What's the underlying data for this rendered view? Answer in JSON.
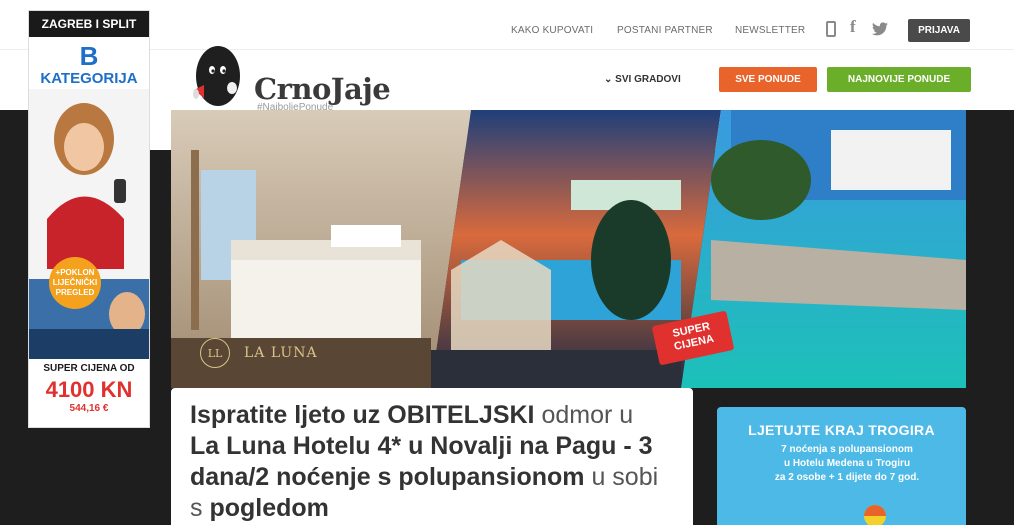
{
  "topnav": {
    "links": [
      "KAKO KUPOVATI",
      "POSTANI PARTNER",
      "NEWSLETTER"
    ],
    "login_label": "PRIJAVA",
    "icons": [
      "phone-icon",
      "facebook-icon",
      "twitter-icon"
    ]
  },
  "header": {
    "brand": "CrnoJaje",
    "tagline": "#NajboljePonude",
    "city_select": "SVI GRADOVI",
    "all_offers_label": "SVE PONUDE",
    "newest_offers_label": "NAJNOVIJE PONUDE"
  },
  "colors": {
    "all_offers": "#e8642a",
    "newest_offers": "#6aae2a",
    "dark_background": "#1e1e1e",
    "promo_blue": "#4db9e6",
    "ad_blue": "#1e6fc8",
    "price_red": "#e0312f"
  },
  "hero": {
    "hotel_logo_text": "LA LUNA",
    "hotel_logo_mark": "LL",
    "tag_line1": "SUPER",
    "tag_line2": "CIJENA"
  },
  "offer": {
    "title_parts": [
      {
        "text": "Ispratite ljeto uz OBITELJSKI",
        "bold": true
      },
      {
        "text": " odmor u ",
        "bold": false
      },
      {
        "text": "La Luna Hotelu 4* u Novalji na Pagu - 3 dana/2 noćenje s polupansionom",
        "bold": true
      },
      {
        "text": " u sobi s ",
        "bold": false
      },
      {
        "text": "pogledom",
        "bold": true
      }
    ]
  },
  "promo": {
    "heading": "LJETUJTE KRAJ TROGIRA",
    "text_line1": "7 noćenja s polupansionom",
    "text_line2": "u Hotelu Medena u Trogiru",
    "text_line3": "za 2 osobe + 1 dijete do 7 god."
  },
  "ad": {
    "cities": "ZAGREB I SPLIT",
    "letter": "B",
    "category": "KATEGORIJA",
    "gift_line1": "+POKLON",
    "gift_line2": "LIJEČNIČKI",
    "gift_line3": "PREGLED",
    "price_label": "SUPER CIJENA OD",
    "price_kn": "4100 KN",
    "price_eur": "544,16 €"
  }
}
